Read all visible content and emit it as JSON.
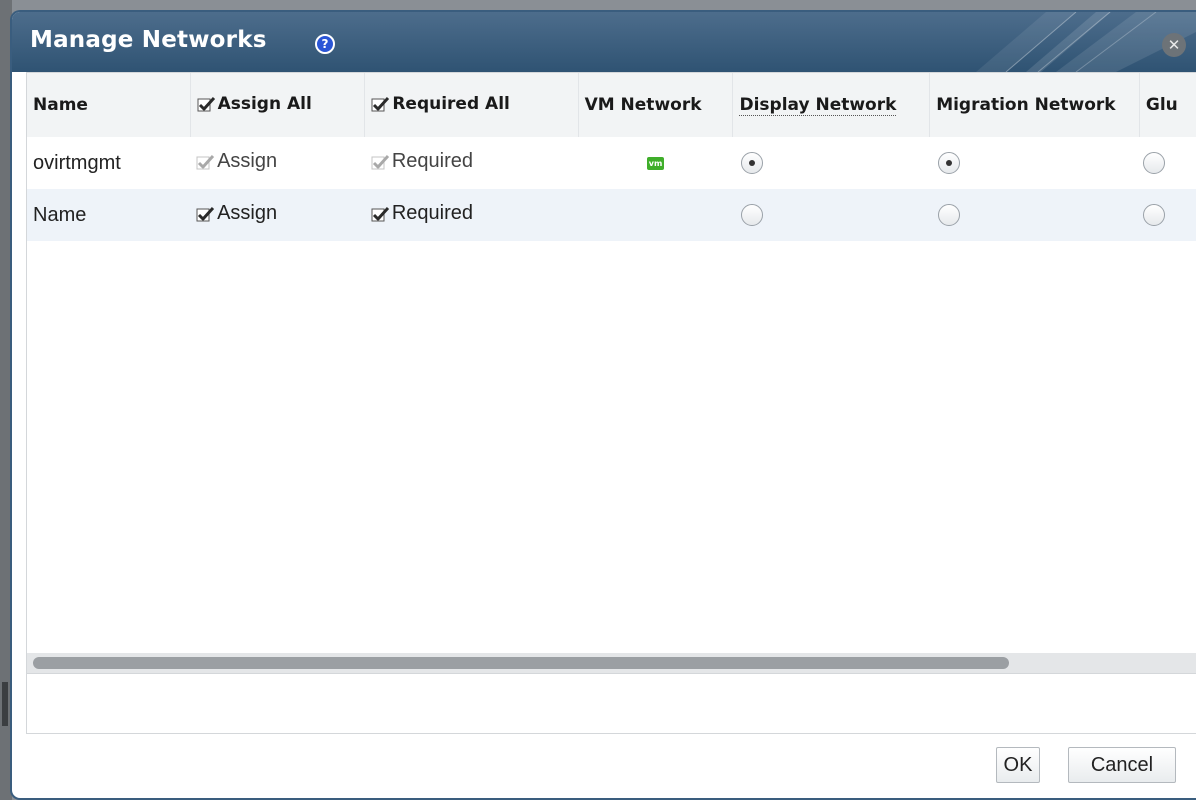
{
  "dialog": {
    "title": "Manage Networks",
    "help_glyph": "?",
    "close_glyph": "✕",
    "accent_color": "#2f5373"
  },
  "columns": {
    "name": "Name",
    "assign_all": "Assign All",
    "required_all": "Required All",
    "vm_network": "VM Network",
    "display_network": "Display Network",
    "migration_network": "Migration Network",
    "partial": "Glu"
  },
  "header_checks": {
    "assign_all_checked": true,
    "required_all_checked": true
  },
  "rows": [
    {
      "name": "ovirtmgmt",
      "assign_label": "Assign",
      "assign_checked": true,
      "assign_disabled": true,
      "required_label": "Required",
      "required_checked": true,
      "required_disabled": true,
      "vm_network_icon": "vm",
      "display_selected": true,
      "migration_selected": true,
      "partial_selected": false
    },
    {
      "name": "Name",
      "assign_label": "Assign",
      "assign_checked": true,
      "assign_disabled": false,
      "required_label": "Required",
      "required_checked": true,
      "required_disabled": false,
      "vm_network_icon": "",
      "display_selected": false,
      "migration_selected": false,
      "partial_selected": false
    }
  ],
  "buttons": {
    "ok": "OK",
    "cancel": "Cancel"
  }
}
